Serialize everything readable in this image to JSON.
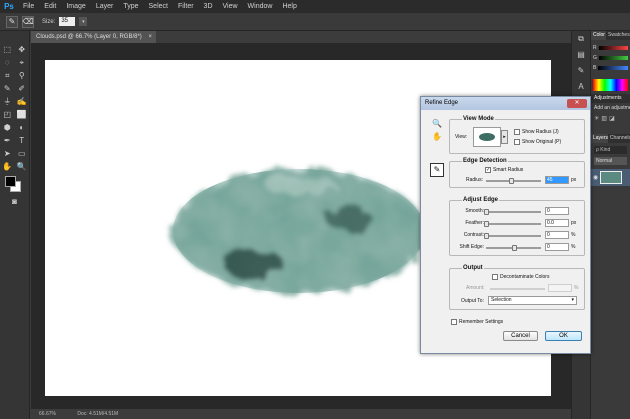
{
  "app": {
    "logo": "Ps"
  },
  "menu": [
    "File",
    "Edit",
    "Image",
    "Layer",
    "Type",
    "Select",
    "Filter",
    "3D",
    "View",
    "Window",
    "Help"
  ],
  "options_bar": {
    "size_label": "Size:",
    "size_value": "35",
    "brush_icon": "brush-icon",
    "eraser_icon": "eraser-icon"
  },
  "document": {
    "tab_title": "Clouds.psd @ 66.7% (Layer 0, RGB/8*)",
    "tab_close": "×",
    "status_zoom": "66.67%",
    "status_doc": "Doc: 4.51M/4.51M"
  },
  "tools": {
    "rows": [
      [
        "⬚",
        "✥"
      ],
      [
        "◌",
        "⌖"
      ],
      [
        "⌗",
        "⚲"
      ],
      [
        "✎",
        "✐"
      ],
      [
        "⏚",
        "✍"
      ],
      [
        "◰",
        "⬜"
      ],
      [
        "⬢",
        "◐"
      ],
      [
        "✒",
        "T"
      ],
      [
        "➤",
        "▭"
      ],
      [
        "✋",
        "🔍"
      ]
    ]
  },
  "right_panel": {
    "color_tab": "Color",
    "swatches_tab": "Swatches",
    "color_rows": [
      {
        "label": "R",
        "color": "#ff4444"
      },
      {
        "label": "G",
        "color": "#44cc44"
      },
      {
        "label": "B",
        "color": "#4488ff"
      }
    ],
    "adjustments_tab": "Adjustments",
    "add_adjustment": "Add an adjustment",
    "layers_tab": "Layers",
    "channels_tab": "Channels",
    "kind_label": "ρ Kind",
    "blend_mode": "Normal",
    "layer_eye": "◉"
  },
  "dialog": {
    "title": "Refine Edge",
    "close": "✕",
    "view_mode": {
      "title": "View Mode",
      "view_label": "View:",
      "show_radius": "Show Radius (J)",
      "show_original": "Show Original (P)"
    },
    "edge_detection": {
      "title": "Edge Detection",
      "smart_radius": "Smart Radius",
      "smart_radius_checked": "✓",
      "radius_label": "Radius:",
      "radius_value": "45",
      "radius_unit": "px",
      "radius_level": 0.45
    },
    "adjust_edge": {
      "title": "Adjust Edge",
      "rows": [
        {
          "label": "Smooth:",
          "value": "0",
          "unit": "",
          "level": 0.0
        },
        {
          "label": "Feather:",
          "value": "0.0",
          "unit": "px",
          "level": 0.0
        },
        {
          "label": "Contrast:",
          "value": "0",
          "unit": "%",
          "level": 0.0
        },
        {
          "label": "Shift Edge:",
          "value": "0",
          "unit": "%",
          "level": 0.5
        }
      ]
    },
    "output": {
      "title": "Output",
      "decontaminate": "Decontaminate Colors",
      "amount_label": "Amount:",
      "amount_unit": "%",
      "output_to_label": "Output To:",
      "output_to_value": "Selection",
      "dropdown_arrow": "▾"
    },
    "remember_settings": "Remember Settings",
    "cancel": "Cancel",
    "ok": "OK"
  }
}
